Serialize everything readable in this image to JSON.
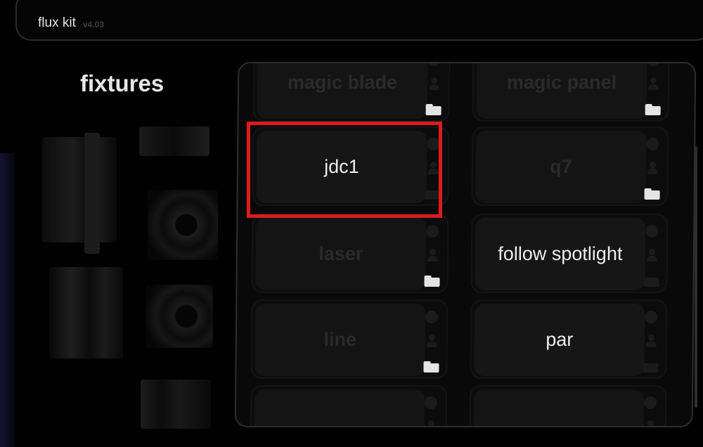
{
  "app": {
    "name": "flux kit",
    "version": "v4.03"
  },
  "section": {
    "title": "fixtures"
  },
  "fixtures": [
    {
      "label": "magic blade",
      "enabled": false
    },
    {
      "label": "magic panel",
      "enabled": false
    },
    {
      "label": "jdc1",
      "enabled": true
    },
    {
      "label": "q7",
      "enabled": false
    },
    {
      "label": "laser",
      "enabled": false
    },
    {
      "label": "follow spotlight",
      "enabled": true
    },
    {
      "label": "line",
      "enabled": false
    },
    {
      "label": "par",
      "enabled": true
    },
    {
      "label": "",
      "enabled": false
    },
    {
      "label": "",
      "enabled": false
    }
  ],
  "highlight": {
    "target": "jdc1",
    "color": "#dd1b1b"
  },
  "icons": [
    "clock-icon",
    "user-icon",
    "folder-icon"
  ]
}
